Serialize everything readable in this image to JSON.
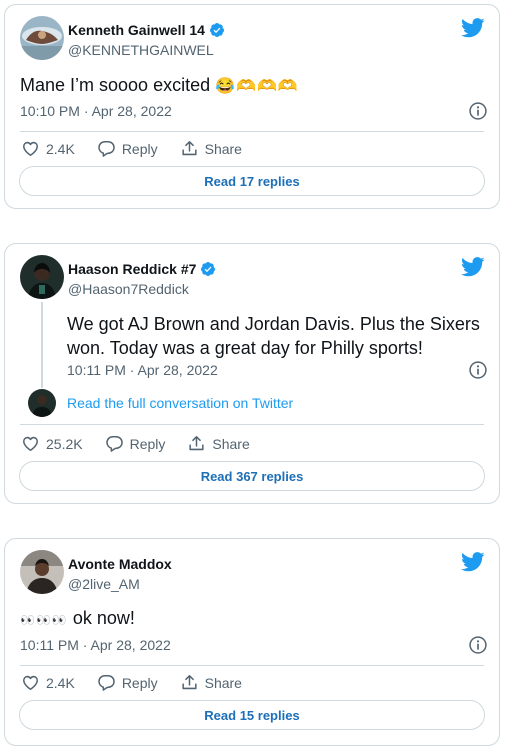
{
  "colors": {
    "accent": "#1d9bf0",
    "text": "#0f1419",
    "muted": "#536471",
    "border": "#cfd9de"
  },
  "icons": [
    "verified-badge-icon",
    "twitter-bird-icon",
    "info-icon",
    "heart-icon",
    "reply-icon",
    "share-icon"
  ],
  "tweets": [
    {
      "display_name": "Kenneth Gainwell 14",
      "handle": "@KENNETHGAINWEL",
      "verified": true,
      "text": "Mane I’m soooo excited",
      "emoji": "😂🫶🫶🫶",
      "time": "10:10 PM · Apr 28, 2022",
      "likes": "2.4K",
      "reply_label": "Reply",
      "share_label": "Share",
      "read_replies": "Read 17 replies"
    },
    {
      "display_name": "Haason Reddick #7",
      "handle": "@Haason7Reddick",
      "verified": true,
      "text": "We got AJ Brown and Jordan Davis. Plus the Sixers won. Today was a great day for Philly sports!",
      "time": "10:11 PM · Apr 28, 2022",
      "full_conversation": "Read the full conversation on Twitter",
      "likes": "25.2K",
      "reply_label": "Reply",
      "share_label": "Share",
      "read_replies": "Read 367 replies"
    },
    {
      "display_name": "Avonte Maddox",
      "handle": "@2live_AM",
      "verified": false,
      "emoji": "👀👀👀",
      "text": "ok now!",
      "time": "10:11 PM · Apr 28, 2022",
      "likes": "2.4K",
      "reply_label": "Reply",
      "share_label": "Share",
      "read_replies": "Read 15 replies"
    }
  ]
}
